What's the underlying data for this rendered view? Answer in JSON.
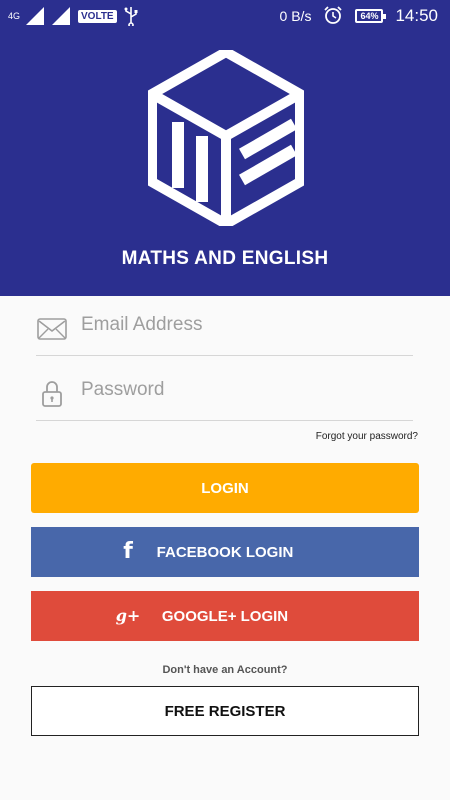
{
  "status_bar": {
    "network": "4G",
    "sim1": "1",
    "sim2": "2",
    "volte": "VOLTE",
    "data_speed": "0 B/s",
    "battery": "64%",
    "time": "14:50"
  },
  "header": {
    "app_title": "MATHS AND ENGLISH",
    "logo_icon": "me-cube-logo",
    "background_color": "#2b2f8f"
  },
  "form": {
    "email": {
      "placeholder": "Email Address",
      "value": "",
      "icon": "envelope-icon"
    },
    "password": {
      "placeholder": "Password",
      "value": "",
      "icon": "lock-icon"
    },
    "forgot_password": "Forgot your password?"
  },
  "buttons": {
    "login": {
      "label": "LOGIN",
      "color": "#ffab00"
    },
    "facebook": {
      "label": "FACEBOOK LOGIN",
      "icon": "f",
      "color": "#4867aa"
    },
    "google": {
      "label": "GOOGLE+ LOGIN",
      "icon": "g+",
      "color": "#df4b3b"
    },
    "register": {
      "label": "FREE REGISTER"
    }
  },
  "footer": {
    "no_account": "Don't have an Account?"
  }
}
